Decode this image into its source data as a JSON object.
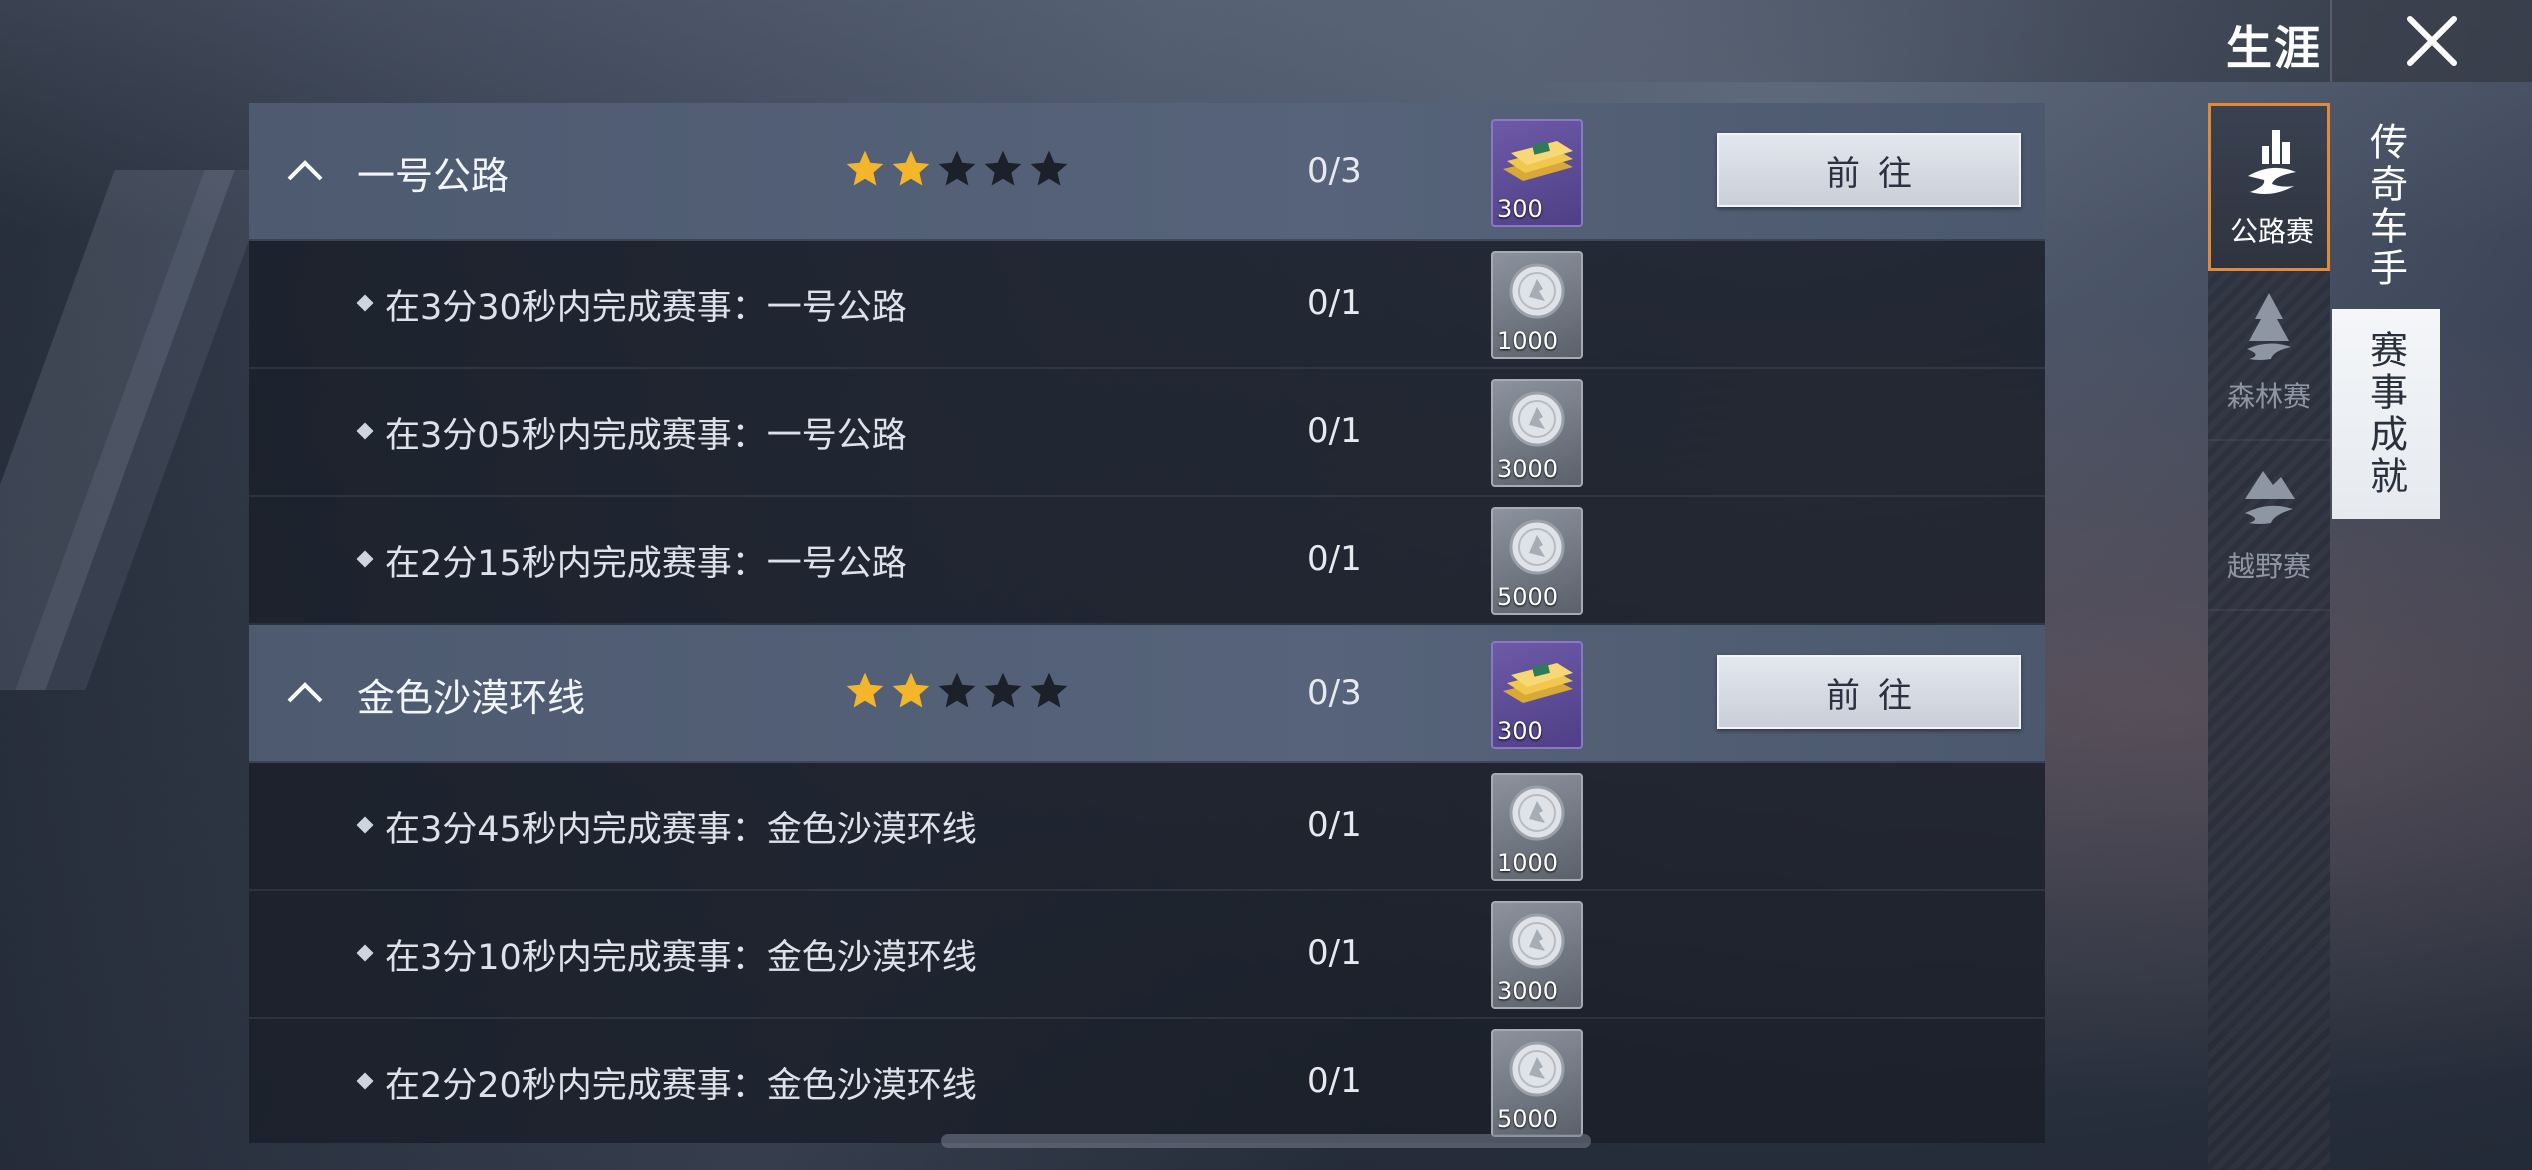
{
  "header": {
    "title": "生涯"
  },
  "groups": [
    {
      "name": "一号公路",
      "stars_filled": 2,
      "stars_total": 5,
      "progress": "0/3",
      "reward_amount": "300",
      "go_label": "前往",
      "tasks": [
        {
          "text": "在3分30秒内完成赛事：一号公路",
          "progress": "0/1",
          "reward_amount": "1000"
        },
        {
          "text": "在3分05秒内完成赛事：一号公路",
          "progress": "0/1",
          "reward_amount": "3000"
        },
        {
          "text": "在2分15秒内完成赛事：一号公路",
          "progress": "0/1",
          "reward_amount": "5000"
        }
      ]
    },
    {
      "name": "金色沙漠环线",
      "stars_filled": 2,
      "stars_total": 5,
      "progress": "0/3",
      "reward_amount": "300",
      "go_label": "前往",
      "tasks": [
        {
          "text": "在3分45秒内完成赛事：金色沙漠环线",
          "progress": "0/1",
          "reward_amount": "1000"
        },
        {
          "text": "在3分10秒内完成赛事：金色沙漠环线",
          "progress": "0/1",
          "reward_amount": "3000"
        },
        {
          "text": "在2分20秒内完成赛事：金色沙漠环线",
          "progress": "0/1",
          "reward_amount": "5000"
        }
      ]
    }
  ],
  "side_tabs": [
    {
      "label": "公路赛",
      "icon": "road-race-icon",
      "active": true
    },
    {
      "label": "森林赛",
      "icon": "forest-race-icon",
      "active": false
    },
    {
      "label": "越野赛",
      "icon": "offroad-race-icon",
      "active": false
    }
  ],
  "category_tabs": [
    {
      "label": "传奇车手",
      "selected": false
    },
    {
      "label": "赛事成就",
      "selected": true
    }
  ],
  "colors": {
    "accent_border": "#e08a3a",
    "star_filled": "#f3b62b",
    "star_empty": "#1c2029",
    "gold_reward_bg": "#5a48a0",
    "silver_reward_bg": "#7a808a"
  }
}
